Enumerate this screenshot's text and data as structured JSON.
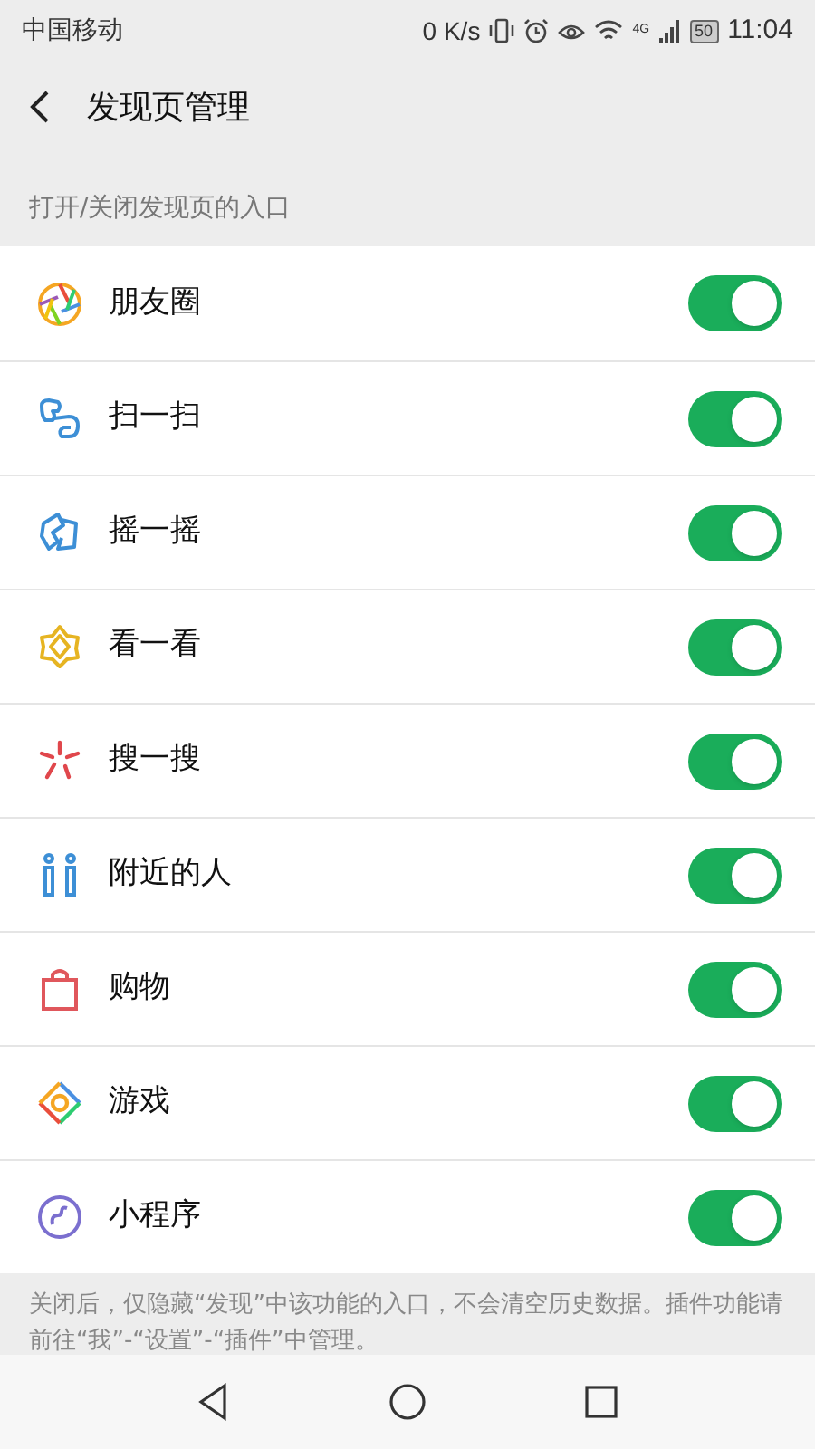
{
  "status_bar": {
    "carrier": "中国移动",
    "speed": "0 K/s",
    "network": "4G",
    "battery": "50",
    "time": "11:04"
  },
  "header": {
    "title": "发现页管理"
  },
  "section": {
    "label": "打开/关闭发现页的入口"
  },
  "items": [
    {
      "kind": "moments",
      "label": "朋友圈",
      "on": true
    },
    {
      "kind": "scan",
      "label": "扫一扫",
      "on": true
    },
    {
      "kind": "shake",
      "label": "摇一摇",
      "on": true
    },
    {
      "kind": "look",
      "label": "看一看",
      "on": true
    },
    {
      "kind": "search",
      "label": "搜一搜",
      "on": true
    },
    {
      "kind": "nearby",
      "label": "附近的人",
      "on": true
    },
    {
      "kind": "shop",
      "label": "购物",
      "on": true
    },
    {
      "kind": "games",
      "label": "游戏",
      "on": true
    },
    {
      "kind": "mini",
      "label": "小程序",
      "on": true
    }
  ],
  "footer": {
    "note": "关闭后，仅隐藏“发现”中该功能的入口，不会清空历史数据。插件功能请前往“我”-“设置”-“插件”中管理。"
  }
}
